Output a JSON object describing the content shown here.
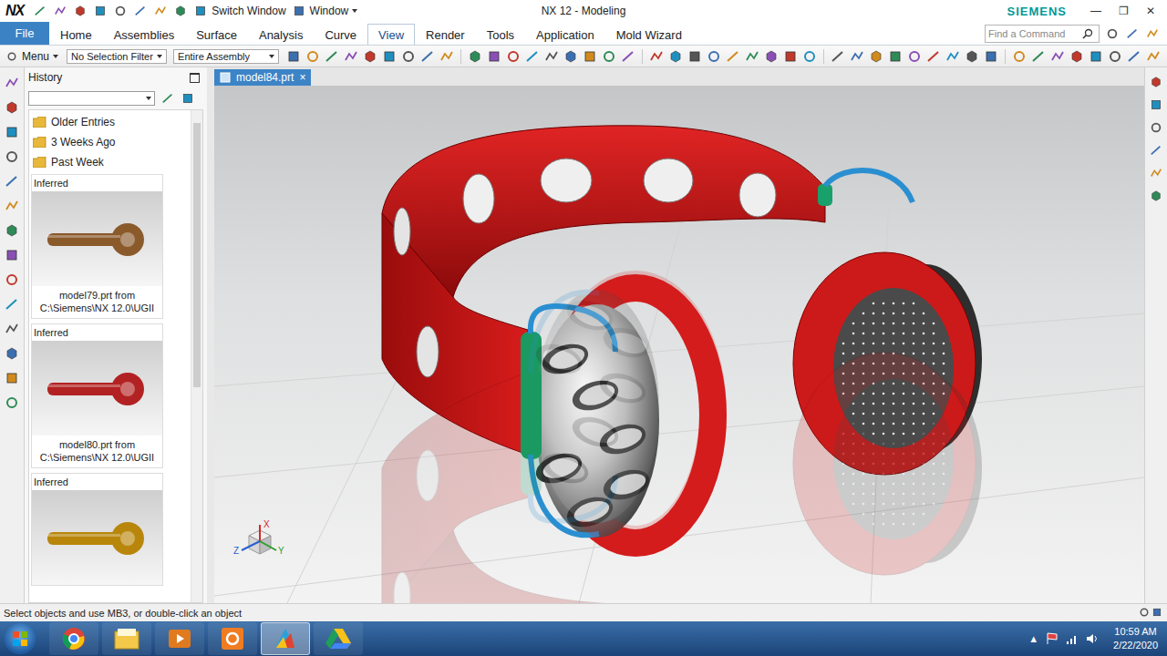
{
  "window": {
    "logo": "NX",
    "quick_access": [
      "Switch Window",
      "Window"
    ],
    "title": "NX 12 - Modeling",
    "brand": "SIEMENS",
    "controls": [
      "—",
      "❐",
      "✕"
    ]
  },
  "ribbon": {
    "file": "File",
    "tabs": [
      {
        "label": "Home",
        "selected": false
      },
      {
        "label": "Assemblies",
        "selected": false
      },
      {
        "label": "Surface",
        "selected": false
      },
      {
        "label": "Analysis",
        "selected": false
      },
      {
        "label": "Curve",
        "selected": false
      },
      {
        "label": "View",
        "selected": true
      },
      {
        "label": "Render",
        "selected": false
      },
      {
        "label": "Tools",
        "selected": false
      },
      {
        "label": "Application",
        "selected": false
      },
      {
        "label": "Mold Wizard",
        "selected": false
      }
    ],
    "search": {
      "placeholder": "Find a Command"
    }
  },
  "toolbar": {
    "menu": "Menu",
    "filters": [
      "No Selection Filter",
      "Entire Assembly"
    ]
  },
  "history": {
    "title": "History",
    "folders": [
      "Older Entries",
      "3 Weeks Ago",
      "Past Week"
    ],
    "entries": [
      {
        "label": "Inferred",
        "file": "model79.prt from",
        "path": "C:\\Siemens\\NX 12.0\\UGII",
        "color": "#8b5a2b"
      },
      {
        "label": "Inferred",
        "file": "model80.prt from",
        "path": "C:\\Siemens\\NX 12.0\\UGII",
        "color": "#b22222"
      },
      {
        "label": "Inferred",
        "color": "#b8860b"
      }
    ]
  },
  "document_tab": {
    "label": "model84.prt",
    "selected": true,
    "close": "×"
  },
  "triad": [
    "Z",
    "X",
    "Y"
  ],
  "status_bar": {
    "text": "Select objects and use MB3, or double-click an object"
  },
  "taskbar": {
    "apps": [
      {
        "kind": "chrome",
        "selected": false
      },
      {
        "kind": "explorer",
        "selected": false
      },
      {
        "kind": "media",
        "selected": false
      },
      {
        "kind": "orange",
        "selected": false
      },
      {
        "kind": "nx",
        "selected": true
      },
      {
        "kind": "drive",
        "selected": false
      }
    ],
    "tray_arrow": "▲",
    "time": "10:59 AM",
    "date": "2/22/2020"
  }
}
